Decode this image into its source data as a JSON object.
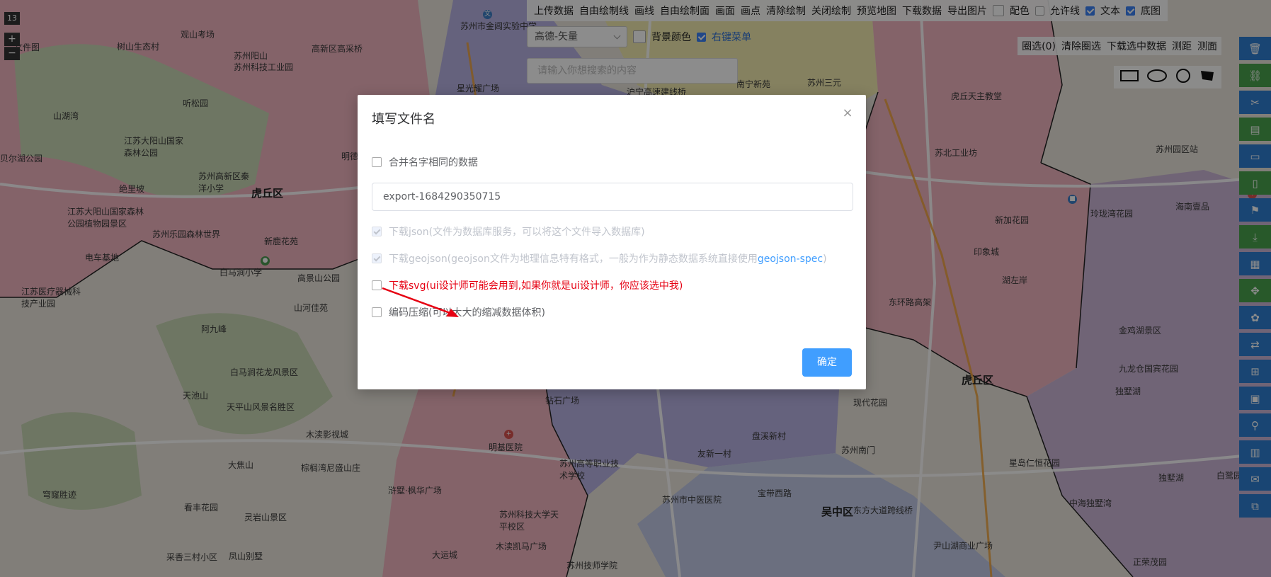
{
  "map": {
    "zoom_level": "13",
    "zoom_in": "+",
    "zoom_out": "−",
    "labels": [
      "文件图",
      "观山考场",
      "树山生态村",
      "苏州阳山",
      "苏州科技工业园",
      "高新区高采桥",
      "听松园",
      "山湖湾",
      "江苏大阳山国家森林公园",
      "贝尔湖公园",
      "苏州高新区秦洋小学",
      "绝里坡",
      "虎丘区",
      "明德",
      "江苏大阳山国家森林公园植物园景区",
      "苏州乐园森林世界",
      "新鹿花苑",
      "电车基地",
      "高景山公园",
      "白马涧小学",
      "山河佳苑",
      "江苏医疗器械科技产业园",
      "阿九峰",
      "白马涧花龙风景区",
      "天池山",
      "天平山风景名胜区",
      "木渎影视城",
      "大焦山",
      "棕榈湾尼盛山庄",
      "穹窿胜迹",
      "看丰花园",
      "灵岩山景区",
      "采香三村小区",
      "凤山别墅",
      "苏州市金阊实验中学",
      "星光耀广场",
      "沪宁高速建线桥",
      "苏州三元",
      "南宁新苑",
      "虎丘天主教堂",
      "苏北工业坊",
      "苏州园区站",
      "新加花园",
      "玲珑湾花园",
      "海南壹品",
      "印象城",
      "东环路高架",
      "湖左岸",
      "金鸡湖景区",
      "九龙仓国宾花园",
      "虎丘区",
      "独墅湖",
      "现代花园",
      "盘溪新村",
      "苏州南门",
      "星岛仁恒花园",
      "独墅湖",
      "白鹭园",
      "钻石广场",
      "明基医院",
      "苏州高等职业技术学校",
      "苏州市中医医院",
      "友新一村",
      "宝带西路",
      "东方大道跨线桥",
      "中海独墅湾",
      "尹山湖商业广场",
      "正荣茂园",
      "苏州科技大学天平校区",
      "木渎凯马广场",
      "苏州技师学院",
      "大运城",
      "浒墅·枫华广场",
      "吴中区"
    ]
  },
  "toolbar": {
    "items": [
      "上传数据",
      "自由绘制线",
      "画线",
      "自由绘制面",
      "画面",
      "画点",
      "清除绘制",
      "关闭绘制",
      "预览地图",
      "下载数据",
      "导出图片"
    ],
    "color_label": "配色",
    "allow_line_label": "允许线",
    "text_label": "文本",
    "basemap_label": "底图",
    "map_type_value": "高德-矢量",
    "bg_color_label": "背景颜色",
    "right_menu_label": "右键菜单",
    "search_placeholder": "请输入你想搜索的内容",
    "right_tools": [
      "圈选(0)",
      "清除圈选",
      "下载选中数据",
      "测距",
      "测面"
    ]
  },
  "dialog": {
    "title": "填写文件名",
    "close": "×",
    "merge_label": "合并名字相同的数据",
    "filename_value": "export-1684290350715",
    "json_label": "下载json(文件为数据库服务，可以将这个文件导入数据库)",
    "geojson_label": "下载geojson(geojson文件为地理信息特有格式，一般为作为静态数据系统直接使用",
    "geojson_link": "geojson-spec",
    "geojson_tail": ")",
    "svg_label": "下载svg(ui设计师可能会用到,如果你就是ui设计师，你应该选中我)",
    "compress_label": "编码压缩(可以大大的缩减数据体积)",
    "ok_label": "确定"
  },
  "colors": {
    "accent": "#409eff",
    "sidebar_green": "#4aa34d",
    "warning_red": "#e60012"
  },
  "icons": [
    "trash-icon",
    "link-icon",
    "scissors-icon",
    "book-icon",
    "file-icon",
    "file-add-icon",
    "flag-icon",
    "download-icon",
    "grid-icon",
    "move-icon",
    "flower-icon",
    "swap-icon",
    "expand-icon",
    "frame-icon",
    "pin-icon",
    "book-open-icon",
    "chat-icon",
    "copy-icon"
  ]
}
